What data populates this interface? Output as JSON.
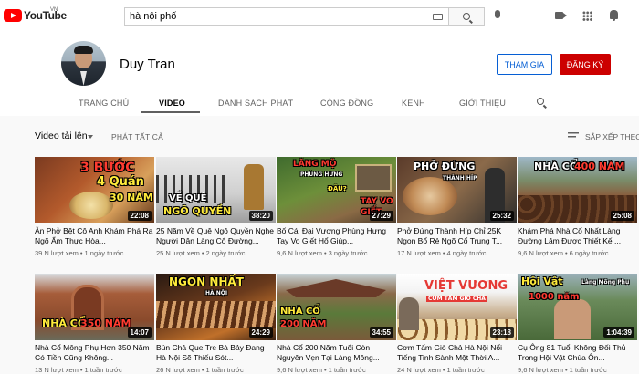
{
  "header": {
    "logo_text": "YouTube",
    "country": "VN",
    "search_value": "hà nội phố"
  },
  "channel": {
    "name": "Duy Tran",
    "join_label": "THAM GIA",
    "subscribe_label": "ĐĂNG KÝ"
  },
  "tabs": [
    {
      "label": "TRANG CHỦ"
    },
    {
      "label": "VIDEO"
    },
    {
      "label": "DANH SÁCH PHÁT"
    },
    {
      "label": "CỘNG ĐỒNG"
    },
    {
      "label": "KÊNH"
    },
    {
      "label": "GIỚI THIỆU"
    }
  ],
  "filter": {
    "uploads_label": "Video tải lên",
    "play_all_label": "PHÁT TẤT CẢ",
    "sort_label": "SẮP XẾP THEO"
  },
  "videos": [
    {
      "title": "Ăn Phở Bệt Cô Anh Khám Phá Ra Ngõ Ẩm Thực Hòa...",
      "views": "39 N lượt xem",
      "age": "1 ngày trước",
      "duration": "22:08",
      "overlay": [
        "3 BƯỚC",
        "4 Quán",
        "30 NĂM"
      ]
    },
    {
      "title": "25 Năm Về Quê Ngô Quyền Nghe Người Dân Làng Cổ Đường...",
      "views": "25 N lượt xem",
      "age": "2 ngày trước",
      "duration": "38:20",
      "overlay": [
        "VỀ QUÊ",
        "NGÔ QUYỀN"
      ]
    },
    {
      "title": "Bố Cái Đại Vương Phùng Hưng Tay Vo Giết Hổ Giúp...",
      "views": "9,6 N lượt xem",
      "age": "3 ngày trước",
      "duration": "27:29",
      "overlay": [
        "LĂNG MỘ",
        "PHÙNG HƯNG",
        "ĐÂU?",
        "TAY VO",
        "GIẾT"
      ]
    },
    {
      "title": "Phở Đứng Thành Híp Chỉ 25K Ngon Bổ Rẻ Ngõ Cổ Trung T...",
      "views": "17 N lượt xem",
      "age": "4 ngày trước",
      "duration": "25:32",
      "overlay": [
        "PHỞ ĐỨNG",
        "THÀNH HÍP"
      ]
    },
    {
      "title": "Khám Phá Nhà Cổ Nhất Làng Đường Lâm Được Thiết Kế ...",
      "views": "9,6 N lượt xem",
      "age": "6 ngày trước",
      "duration": "25:08",
      "overlay": [
        "NHÀ CỔ",
        "400 NĂM"
      ]
    },
    {
      "title": "Nhà Cổ Mông Phụ Hơn 350 Năm Có Tiền Cũng Không...",
      "views": "13 N lượt xem",
      "age": "1 tuần trước",
      "duration": "14:07",
      "overlay": [
        "NHÀ CỔ",
        "350 NĂM"
      ]
    },
    {
      "title": "Bún Chả Que Tre Bà Bảy Đang Hà Nội Sẽ Thiếu Sót...",
      "views": "26 N lượt xem",
      "age": "1 tuần trước",
      "duration": "24:29",
      "overlay": [
        "NGON NHẤT",
        "HÀ NỘI"
      ]
    },
    {
      "title": "Nhà Cổ 200 Năm Tuổi Còn Nguyên Vẹn Tại Làng Mông...",
      "views": "9,6 N lượt xem",
      "age": "1 tuần trước",
      "duration": "34:55",
      "overlay": [
        "NHÀ CỔ",
        "200 NĂM"
      ]
    },
    {
      "title": "Cơm Tấm Giò Chả Hà Nội Nổi Tiếng Tinh Sành Một Thời A...",
      "views": "24 N lượt xem",
      "age": "1 tuần trước",
      "duration": "23:18",
      "overlay": [
        "VIỆT VƯƠNG",
        "CƠM TẤM GIÒ CHẢ"
      ]
    },
    {
      "title": "Cụ Ông 81 Tuổi Không Đối Thủ Trong Hội Vật Chùa Ôn...",
      "views": "9,6 N lượt xem",
      "age": "1 tuần trước",
      "duration": "1:04:39",
      "overlay": [
        "Hội Vật",
        "1000 năm",
        "Làng Mông Phụ"
      ]
    }
  ],
  "icons": [
    "youtube-logo-icon",
    "keyboard-icon",
    "search-icon",
    "mic-icon",
    "create-video-icon",
    "apps-icon",
    "bell-icon",
    "channel-search-icon",
    "sort-icon",
    "dropdown-caret-icon"
  ],
  "colors": {
    "brand_red": "#ff0000",
    "subscribe_red": "#cc0000",
    "join_blue": "#065fd4",
    "duration_bg": "#000000"
  }
}
